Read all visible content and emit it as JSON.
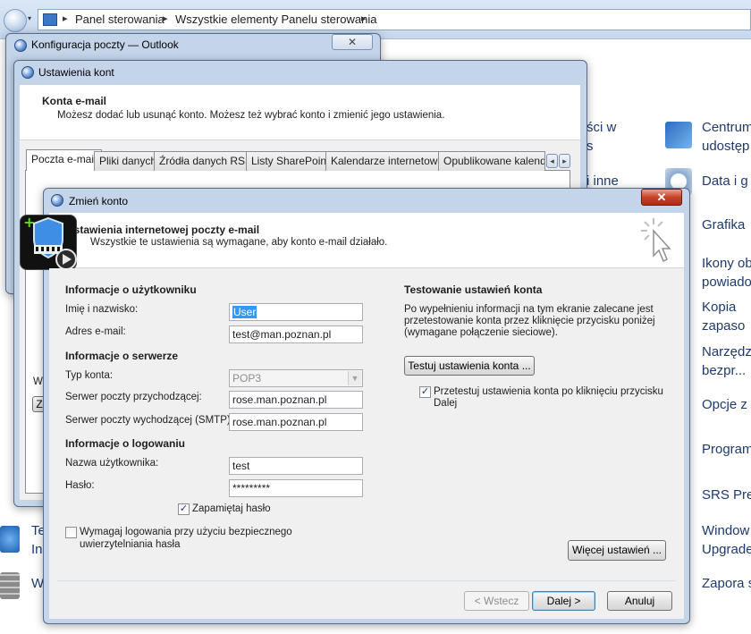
{
  "explorer": {
    "breadcrumb": [
      "Panel sterowania",
      "Wszystkie elementy Panelu sterowania"
    ],
    "left_fragments": [
      "Te",
      "In",
      "W"
    ],
    "middle_fragments": [
      "ści w",
      "s",
      "i inne"
    ],
    "right_items": [
      "Centrum",
      "udostęp",
      "Data i g",
      "Grafika",
      "Ikony ob",
      "powiado",
      "Kopia",
      "zapaso",
      "Narzędz",
      "bezpr...",
      "Opcje z",
      "Program",
      "SRS Pre",
      "Window",
      "Upgrade",
      "Zapora s"
    ]
  },
  "config_window": {
    "title": "Konfiguracja poczty — Outlook",
    "close_label": "✕"
  },
  "accounts_window": {
    "title": "Ustawienia kont",
    "heading": "Konta e-mail",
    "description": "Możesz dodać lub usunąć konto. Możesz też wybrać konto i zmienić jego ustawienia.",
    "tabs": [
      "Poczta e-mail",
      "Pliki danych",
      "Źródła danych RSS",
      "Listy SharePoint",
      "Kalendarze internetowe",
      "Opublikowane kalendar..."
    ],
    "tab_scroll_left": "◂",
    "tab_scroll_right": "▸",
    "left_fragments": [
      "W",
      "Z"
    ]
  },
  "change_dialog": {
    "title": "Zmień konto",
    "close_label": "✕",
    "header_title": "Ustawienia internetowej poczty e-mail",
    "header_desc": "Wszystkie te ustawienia są wymagane, aby konto e-mail działało.",
    "user_info": {
      "heading": "Informacje o użytkowniku",
      "name_label": "Imię i nazwisko:",
      "name_value": "User",
      "email_label": "Adres e-mail:",
      "email_value": "test@man.poznan.pl"
    },
    "server_info": {
      "heading": "Informacje o serwerze",
      "type_label": "Typ konta:",
      "type_value": "POP3",
      "incoming_label": "Serwer poczty przychodzącej:",
      "incoming_value": "rose.man.poznan.pl",
      "outgoing_label": "Serwer poczty wychodzącej (SMTP):",
      "outgoing_value": "rose.man.poznan.pl"
    },
    "login_info": {
      "heading": "Informacje o logowaniu",
      "user_label": "Nazwa użytkownika:",
      "user_value": "test",
      "password_label": "Hasło:",
      "password_value": "*********",
      "remember_label": "Zapamiętaj hasło",
      "remember_checked": true,
      "spa_label_1": "Wymagaj logowania przy użyciu bezpiecznego",
      "spa_label_2": "uwierzytelniania hasła",
      "spa_checked": false
    },
    "test": {
      "heading": "Testowanie ustawień konta",
      "desc_1": "Po wypełnieniu informacji na tym ekranie zalecane jest",
      "desc_2": "przetestowanie konta przez kliknięcie przycisku poniżej",
      "desc_3": "(wymagane połączenie sieciowe).",
      "test_button": "Testuj ustawienia konta ...",
      "auto_test_label_1": "Przetestuj ustawienia konta po kliknięciu przycisku",
      "auto_test_label_2": "Dalej",
      "auto_test_checked": true
    },
    "more_settings": "Więcej ustawień ...",
    "back": "< Wstecz",
    "next": "Dalej >",
    "cancel": "Anuluj",
    "check_mark": "✓"
  },
  "colors": {
    "explorer_link": "#1e3a6e",
    "window_frame": "#c4d5ea",
    "selection": "#3399ff",
    "close_red": "#c7432b"
  }
}
